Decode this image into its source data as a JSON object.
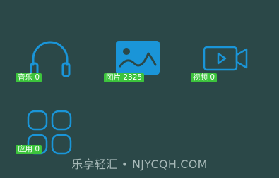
{
  "tiles": [
    {
      "id": "music",
      "label": "音乐 0",
      "icon": "headphones-icon"
    },
    {
      "id": "pictures",
      "label": "图片 2325",
      "icon": "image-icon"
    },
    {
      "id": "videos",
      "label": "视频 0",
      "icon": "video-camera-icon"
    },
    {
      "id": "apps",
      "label": "应用 0",
      "icon": "apps-grid-icon"
    }
  ],
  "watermark": "乐享轻汇 • NJYCQH.COM",
  "colors": {
    "background": "#2b4848",
    "icon_blue": "#1a95d8",
    "badge_green": "#3cc43c",
    "watermark_text": "#a7b9b8"
  }
}
